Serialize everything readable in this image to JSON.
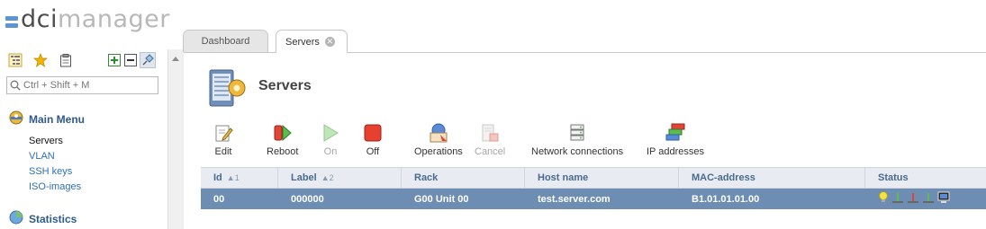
{
  "app": {
    "logo_left": "dci",
    "logo_right": "manager"
  },
  "sidebar": {
    "search_placeholder": "Ctrl + Shift + M",
    "main_menu_title": "Main Menu",
    "items": [
      {
        "label": "Servers",
        "active": true
      },
      {
        "label": "VLAN"
      },
      {
        "label": "SSH keys"
      },
      {
        "label": "ISO-images"
      }
    ],
    "statistics_title": "Statistics"
  },
  "tabs": [
    {
      "label": "Dashboard"
    },
    {
      "label": "Servers",
      "active": true
    }
  ],
  "page": {
    "title": "Servers"
  },
  "toolbar": [
    {
      "label": "Edit",
      "icon": "edit-icon"
    },
    {
      "label": "Reboot",
      "icon": "reboot-icon"
    },
    {
      "label": "On",
      "icon": "power-on-icon",
      "disabled": true
    },
    {
      "label": "Off",
      "icon": "power-off-icon"
    },
    {
      "label": "Operations",
      "icon": "operations-icon"
    },
    {
      "label": "Cancel",
      "icon": "cancel-icon",
      "disabled": true
    },
    {
      "label": "Network connections",
      "icon": "network-connections-icon"
    },
    {
      "label": "IP addresses",
      "icon": "ip-addresses-icon"
    }
  ],
  "table": {
    "columns": [
      {
        "label": "Id",
        "sort": "▲1"
      },
      {
        "label": "Label",
        "sort": "▲2"
      },
      {
        "label": "Rack"
      },
      {
        "label": "Host name"
      },
      {
        "label": "MAC-address"
      },
      {
        "label": "Status"
      }
    ],
    "rows": [
      {
        "id": "00",
        "label": "000000",
        "rack": "G00 Unit 00",
        "host": "test.server.com",
        "mac": "B1.01.01.01.00"
      }
    ]
  },
  "colors": {
    "accent": "#6d8db3",
    "link": "#2e6fb4",
    "header_text": "#4a6a8f"
  }
}
